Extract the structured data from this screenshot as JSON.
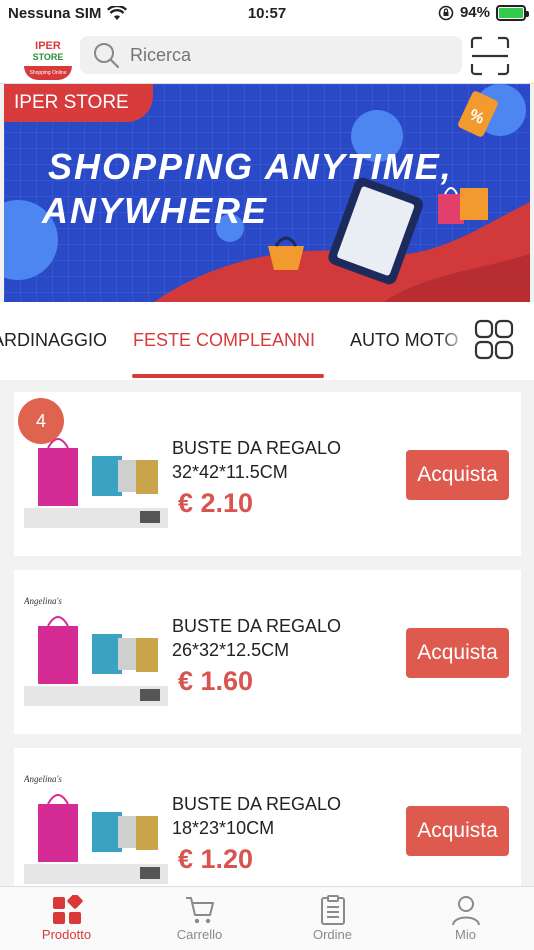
{
  "status_bar": {
    "carrier": "Nessuna SIM",
    "time": "10:57",
    "battery": "94%"
  },
  "header": {
    "logo": {
      "line1": "IPER",
      "line2": "STORE",
      "tagline": "Shopping Online"
    },
    "search_placeholder": "Ricerca"
  },
  "banner": {
    "tag": "IPER STORE",
    "line1": "SHOPPING  ANYTIME,",
    "line2": "ANYWHERE"
  },
  "tabs": [
    {
      "label": "ARDINAGGIO"
    },
    {
      "label": "FESTE  COMPLEANNI",
      "active": true
    },
    {
      "label": "AUTO MOTO"
    }
  ],
  "cart_badge_count": "4",
  "products": [
    {
      "name": "BUSTE DA REGALO 32*42*11.5CM",
      "price": "€ 2.10",
      "buy_label": "Acquista"
    },
    {
      "name": "BUSTE DA REGALO 26*32*12.5CM",
      "price": "€ 1.60",
      "buy_label": "Acquista",
      "thumb_brand": "Angelina's"
    },
    {
      "name": "BUSTE DA REGALO 18*23*10CM",
      "price": "€ 1.20",
      "buy_label": "Acquista",
      "thumb_brand": "Angelina's"
    }
  ],
  "bottom_nav": [
    {
      "label": "Prodotto",
      "icon": "grid-icon",
      "active": true
    },
    {
      "label": "Carrello",
      "icon": "cart-icon"
    },
    {
      "label": "Ordine",
      "icon": "clipboard-icon"
    },
    {
      "label": "Mio",
      "icon": "person-icon"
    }
  ],
  "colors": {
    "accent": "#d83a3a",
    "buy_button": "#de5a4f",
    "price": "#d9534f",
    "banner_blue": "#2a49c6"
  }
}
